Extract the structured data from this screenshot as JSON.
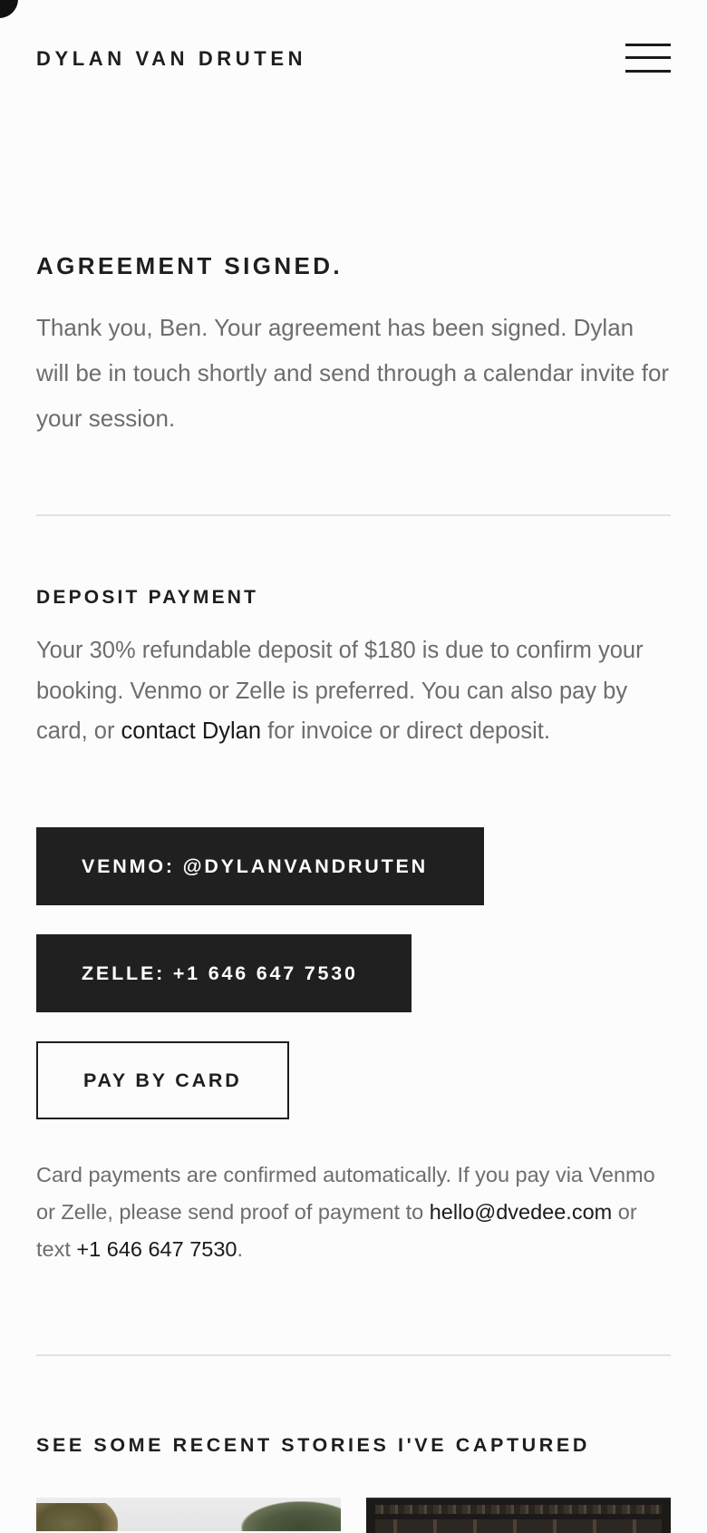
{
  "header": {
    "brand": "DYLAN VAN DRUTEN",
    "menu_icon": "hamburger-menu-icon"
  },
  "agreement": {
    "title": "AGREEMENT SIGNED.",
    "body": "Thank you, Ben. Your agreement has been signed. Dylan will be in touch shortly and send through a calendar invite for your session."
  },
  "deposit": {
    "title": "DEPOSIT PAYMENT",
    "body_before_link": "Your 30% refundable deposit of $180 is due to confirm your booking. Venmo or Zelle is preferred. You can also pay by card, or ",
    "link_label": "contact Dylan",
    "body_after_link": " for invoice or direct deposit."
  },
  "buttons": {
    "venmo_label": "VENMO: @DYLANVANDRUTEN",
    "zelle_label": "ZELLE: +1 646 647 7530",
    "card_label": "PAY BY CARD"
  },
  "note": {
    "text_before": "Card payments are confirmed automatically. If you pay via Venmo or Zelle, please send proof of payment to ",
    "email": "hello@dvedee.com",
    "text_middle": " or text ",
    "phone": "+1 646 647 7530",
    "text_after": "."
  },
  "stories": {
    "title": "SEE SOME RECENT STORIES I'VE CAPTURED"
  },
  "colors": {
    "background": "#fcfcfc",
    "button_dark": "#202020",
    "text_heading": "#1e1e1e",
    "text_body": "#6d6d6d",
    "divider": "#e2e2e2"
  }
}
